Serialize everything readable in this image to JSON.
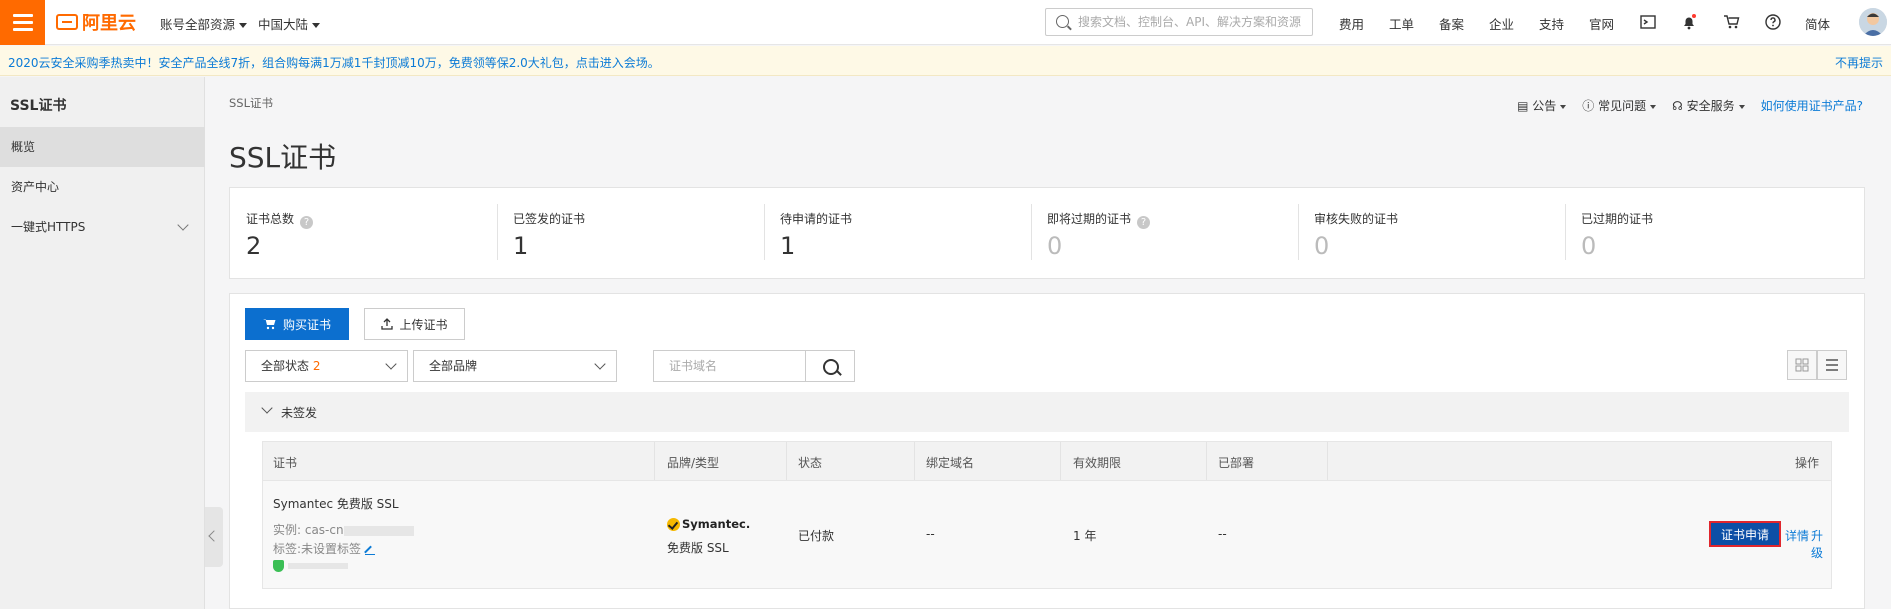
{
  "topbar": {
    "logo_text": "阿里云",
    "account_dropdown": "账号全部资源",
    "region_dropdown": "中国大陆",
    "search_placeholder": "搜索文档、控制台、API、解决方案和资源",
    "nav": [
      "费用",
      "工单",
      "备案",
      "企业",
      "支持",
      "官网"
    ],
    "lang": "简体",
    "icons": [
      "terminal-icon",
      "bell-icon",
      "cart-icon",
      "help-icon"
    ]
  },
  "promo": {
    "text": "2020云安全采购季热卖中！安全产品全线7折，组合购每满1万减1千封顶减10万，免费领等保2.0大礼包，点击进入会场。",
    "dismiss": "不再提示"
  },
  "sidebar": {
    "title": "SSL证书",
    "items": [
      {
        "label": "概览",
        "active": true
      },
      {
        "label": "资产中心",
        "active": false
      },
      {
        "label": "一键式HTTPS",
        "active": false
      }
    ]
  },
  "main": {
    "breadcrumb": "SSL证书",
    "title": "SSL证书",
    "top_links": {
      "notice": "公告",
      "faq": "常见问题",
      "security": "安全服务",
      "howto": "如何使用证书产品?"
    },
    "stats": [
      {
        "label": "证书总数",
        "value": "2",
        "help": true
      },
      {
        "label": "已签发的证书",
        "value": "1",
        "help": false
      },
      {
        "label": "待申请的证书",
        "value": "1",
        "help": false
      },
      {
        "label": "即将过期的证书",
        "value": "0",
        "help": true
      },
      {
        "label": "审核失败的证书",
        "value": "0",
        "help": false
      },
      {
        "label": "已过期的证书",
        "value": "0",
        "help": false
      }
    ],
    "toolbar": {
      "buy": "购买证书",
      "upload": "上传证书",
      "status_filter": "全部状态",
      "status_count": "2",
      "brand_filter": "全部品牌",
      "domain_placeholder": "证书域名"
    },
    "group": {
      "label": "未签发"
    },
    "table": {
      "headers": [
        "证书",
        "品牌/类型",
        "状态",
        "绑定域名",
        "有效期限",
        "已部署",
        "操作"
      ],
      "row": {
        "name": "Symantec 免费版 SSL",
        "instance_label": "实例: cas-cn",
        "tag_label": "标签:未设置标签",
        "brand": "Symantec.",
        "type": "免费版 SSL",
        "status": "已付款",
        "domain": "--",
        "validity": "1 年",
        "deployed": "--",
        "action_apply": "证书申请",
        "action_detail": "详情",
        "action_upgrade": "升级"
      }
    }
  }
}
